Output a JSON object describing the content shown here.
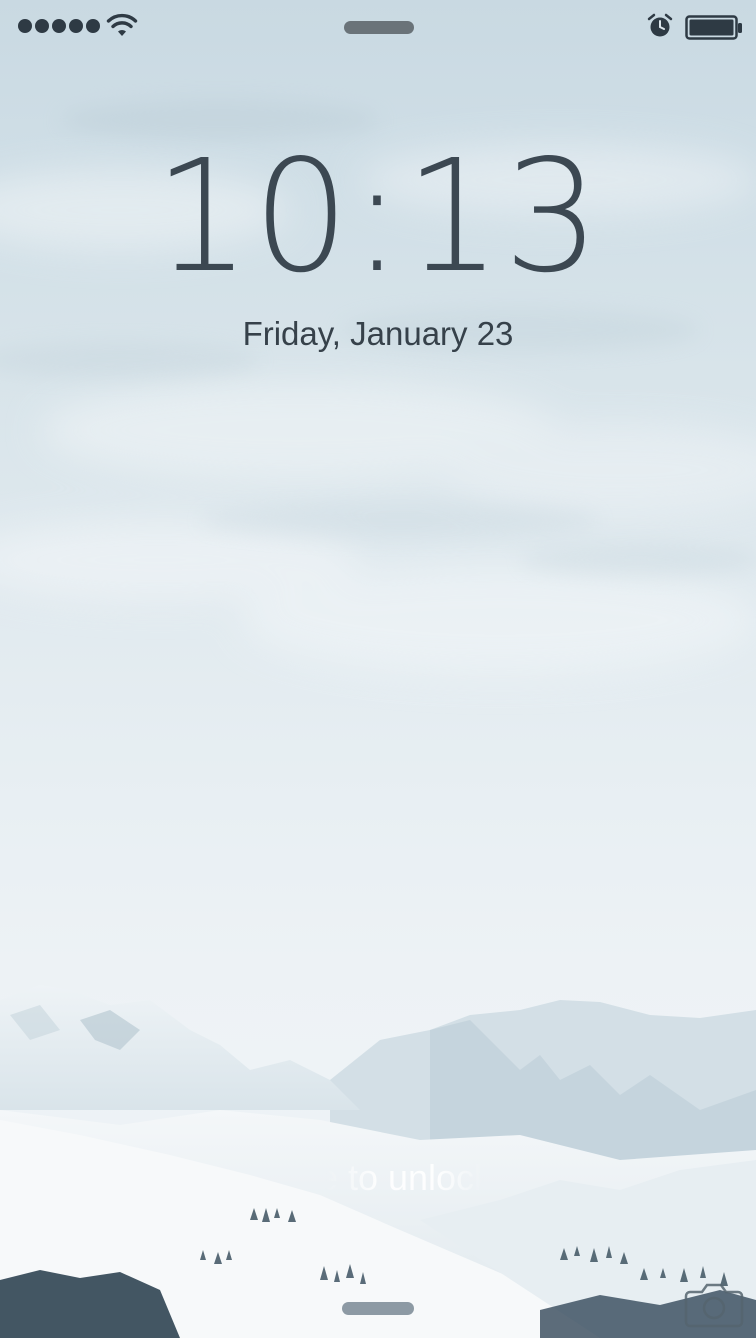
{
  "status_bar": {
    "signal_bars": 5,
    "wifi_icon": "wifi-icon",
    "alarm_icon": "alarm-clock-icon",
    "battery_icon": "battery-full-icon",
    "battery_level": 1.0
  },
  "lock_screen": {
    "time": "10:13",
    "date": "Friday, January 23",
    "slide_to_unlock": "slide to unlock",
    "camera_icon": "camera-icon"
  },
  "colors": {
    "text": "#3c4852",
    "sky_top": "#c9d9e2",
    "sky_bottom": "#eef3f6"
  }
}
